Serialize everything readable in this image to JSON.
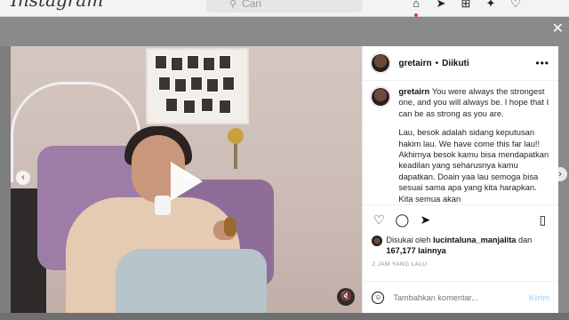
{
  "nav": {
    "brand": "Instagram",
    "search_placeholder": "Cari"
  },
  "post": {
    "username": "gretairn",
    "separator": "•",
    "follow_status": "Diikuti",
    "more": "•••",
    "caption_user": "gretairn",
    "caption_p1": " You were always the strongest one, and you will always be. I hope that I can be as strong as you are.",
    "caption_p2": "Lau, besok adalah sidang keputusan hakim lau. We have come this far lau!! Akhirnya besok kamu bisa mendapatkan keadilan yang seharusnya kamu dapatkan. Doain yaa lau semoga bisa sesuai sama apa yang kita harapkan. Kita semua akan",
    "likes_prefix": "Disukai oleh ",
    "likes_user": "lucintaluna_manjalita",
    "likes_mid": " dan",
    "likes_count": "167,177",
    "likes_suffix": " lainnya",
    "timestamp": "2 JAM YANG LALU",
    "comment_placeholder": "Tambahkan komentar...",
    "send_label": "Kirim"
  },
  "icons": {
    "top": [
      "home-icon",
      "messenger-icon",
      "new-post-icon",
      "explore-icon",
      "heart-icon"
    ],
    "actions": [
      "like-icon",
      "comment-icon",
      "share-icon",
      "save-icon"
    ]
  },
  "colors": {
    "send_disabled": "#b2dffc",
    "overlay": "#8a8a8a"
  }
}
